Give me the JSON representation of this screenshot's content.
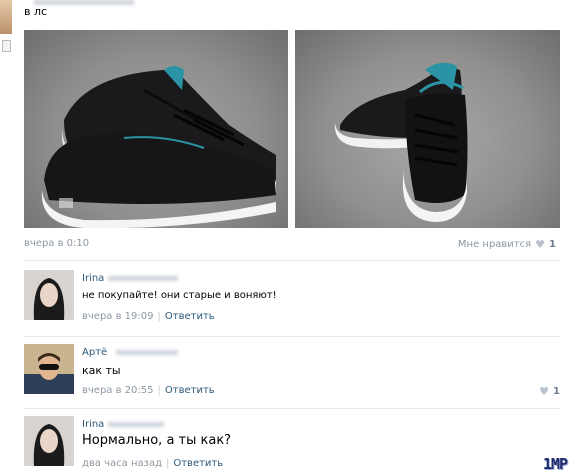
{
  "post": {
    "text": "в лс",
    "time": "вчера в 0:10",
    "likes_label": "Мне нравится",
    "likes_count": "1"
  },
  "comments": [
    {
      "name": "Irina",
      "text": "не покупайте! они старые и воняют!",
      "time": "вчера в 19:09",
      "reply": "Ответить"
    },
    {
      "name": "Артё",
      "text": "как ты",
      "time": "вчера в 20:55",
      "reply": "Ответить",
      "likes_count": "1"
    },
    {
      "name": "Irina",
      "text": "Нормально, а ты как?",
      "time": "два часа назад",
      "reply": "Ответить"
    }
  ],
  "watermark": "1MP",
  "colors": {
    "link": "#2b587a",
    "meta": "#8e98a3",
    "divider": "#e7e8ec"
  }
}
